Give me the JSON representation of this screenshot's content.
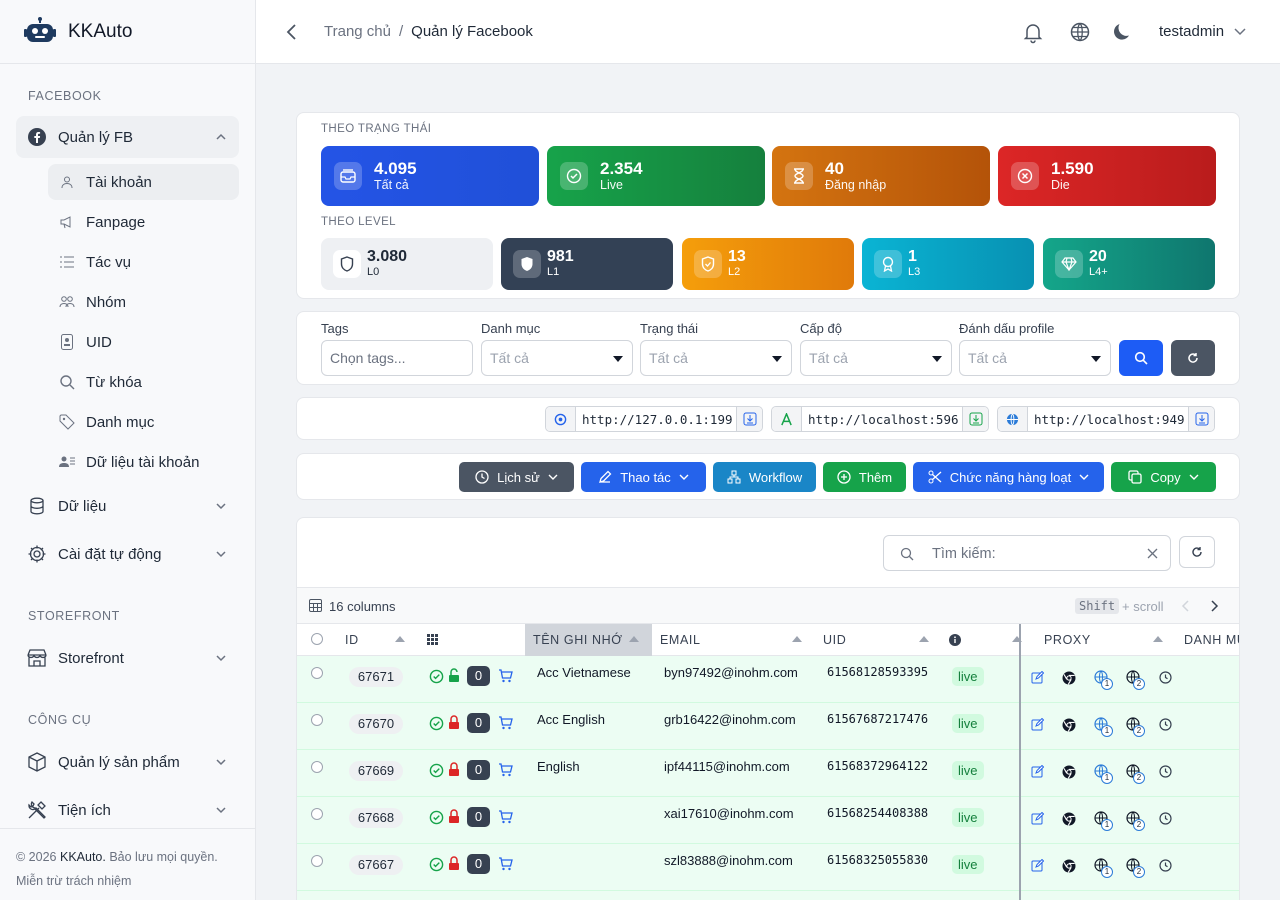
{
  "brand": {
    "name": "KKAuto"
  },
  "sidebar": {
    "sections": [
      "FACEBOOK",
      "STOREFRONT",
      "CÔNG CỤ"
    ],
    "fb_group": "Quản lý FB",
    "sub_items": [
      "Tài khoản",
      "Fanpage",
      "Tác vụ",
      "Nhóm",
      "UID",
      "Từ khóa",
      "Danh mục",
      "Dữ liệu tài khoản"
    ],
    "groups": [
      "Dữ liệu",
      "Cài đặt tự động",
      "Storefront",
      "Quản lý sản phẩm",
      "Tiện ích"
    ],
    "footer_copy": "© 2026",
    "footer_brand": "KKAuto.",
    "footer_rights": "Bảo lưu mọi quyền.",
    "footer_disclaimer": "Miễn trừ trách nhiệm"
  },
  "header": {
    "crumb_home": "Trang chủ",
    "crumb_sep": "/",
    "crumb_current": "Quản lý Facebook",
    "user": "testadmin"
  },
  "status": {
    "label": "THEO TRẠNG THÁI",
    "items": [
      {
        "value": "4.095",
        "label": "Tất cả",
        "color": "#2453e0"
      },
      {
        "value": "2.354",
        "label": "Live",
        "color": "#16a34a"
      },
      {
        "value": "40",
        "label": "Đăng nhập",
        "color": "#c2680c"
      },
      {
        "value": "1.590",
        "label": "Die",
        "color": "#dc2626"
      }
    ]
  },
  "level": {
    "label": "THEO LEVEL",
    "items": [
      {
        "value": "3.080",
        "label": "L0"
      },
      {
        "value": "981",
        "label": "L1"
      },
      {
        "value": "13",
        "label": "L2"
      },
      {
        "value": "1",
        "label": "L3"
      },
      {
        "value": "20",
        "label": "L4+"
      }
    ]
  },
  "filters": {
    "tags_label": "Tags",
    "tags_placeholder": "Chọn tags...",
    "category_label": "Danh mục",
    "category_value": "Tất cả",
    "status_label": "Trạng thái",
    "status_value": "Tất cả",
    "level_label": "Cấp độ",
    "level_value": "Tất cả",
    "mark_label": "Đánh dấu profile",
    "mark_value": "Tất cả"
  },
  "urls": [
    "http://127.0.0.1:199",
    "http://localhost:596",
    "http://localhost:949"
  ],
  "actions": [
    "Lịch sử",
    "Thao tác",
    "Workflow",
    "Thêm",
    "Chức năng hàng loạt",
    "Copy"
  ],
  "table": {
    "search_placeholder": "Tìm kiếm:",
    "columns_count": "16 columns",
    "shift_key": "Shift",
    "shift_hint": "+ scroll",
    "headers": [
      "ID",
      "TÊN GHI NHỚ",
      "EMAIL",
      "UID",
      "PROXY",
      "DANH MỤ"
    ],
    "rows": [
      {
        "id": "67671",
        "count": "0",
        "name": "Acc Vietnamese",
        "email": "byn97492@inohm.com",
        "uid": "61568128593395",
        "status": "live",
        "lock_open": true
      },
      {
        "id": "67670",
        "count": "0",
        "name": "Acc English",
        "email": "grb16422@inohm.com",
        "uid": "61567687217476",
        "status": "live",
        "lock_open": false
      },
      {
        "id": "67669",
        "count": "0",
        "name": "English",
        "email": "ipf44115@inohm.com",
        "uid": "61568372964122",
        "status": "live",
        "lock_open": false
      },
      {
        "id": "67668",
        "count": "0",
        "name": "",
        "email": "xai17610@inohm.com",
        "uid": "61568254408388",
        "status": "live",
        "lock_open": false
      },
      {
        "id": "67667",
        "count": "0",
        "name": "",
        "email": "szl83888@inohm.com",
        "uid": "61568325055830",
        "status": "live",
        "lock_open": false
      }
    ],
    "proxy_counts": [
      "1",
      "2"
    ]
  }
}
